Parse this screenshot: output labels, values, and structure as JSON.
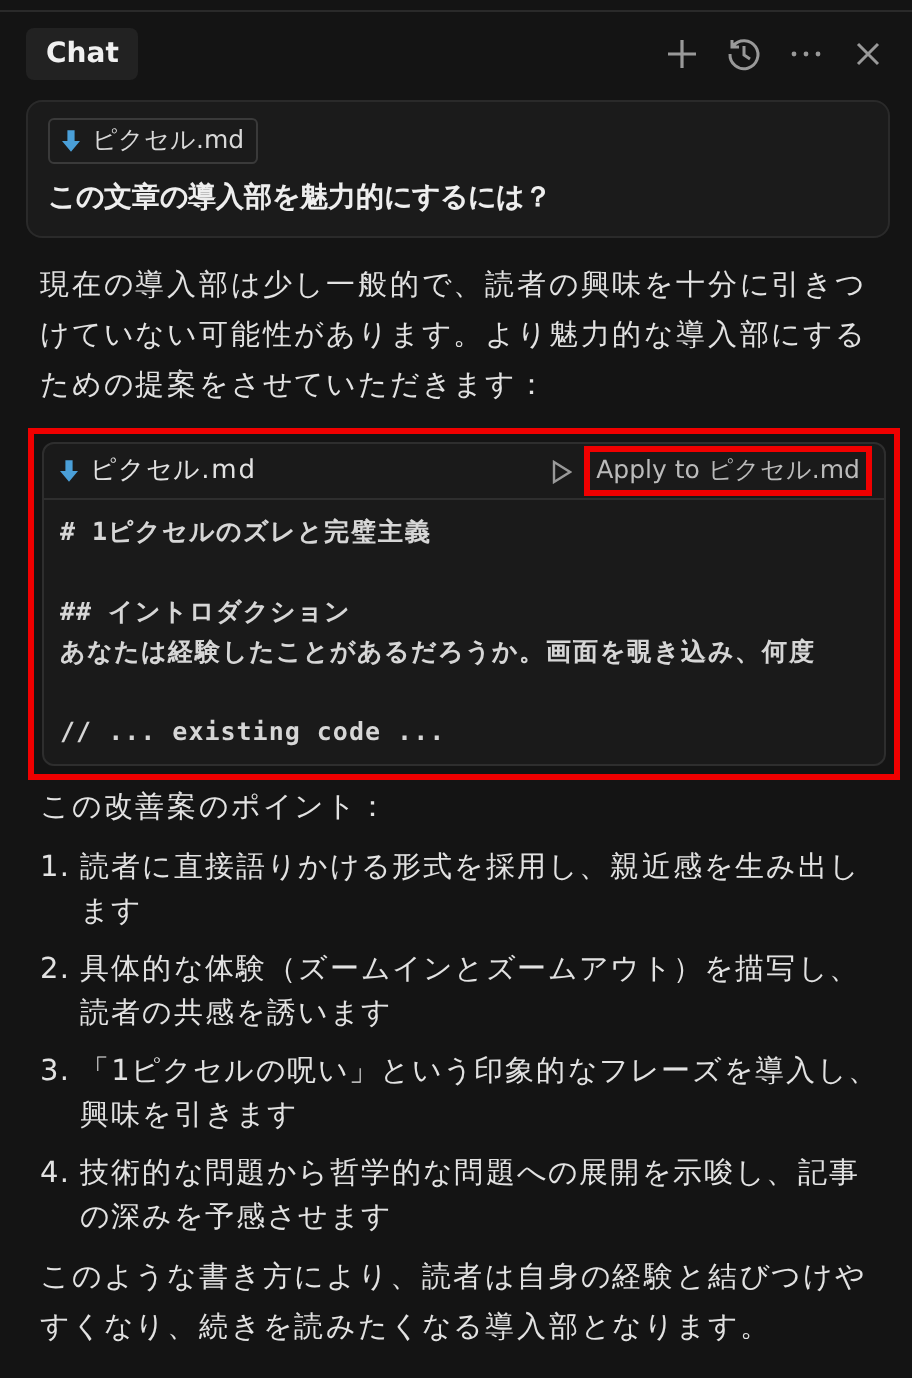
{
  "header": {
    "tab": "Chat"
  },
  "prompt": {
    "attachment": "ピクセル.md",
    "text": "この文章の導入部を魅力的にするには？"
  },
  "response": {
    "intro": "現在の導入部は少し一般的で、読者の興味を十分に引きつけていない可能性があります。より魅力的な導入部にするための提案をさせていただきます：",
    "code_block": {
      "highlighted": true,
      "filename": "ピクセル.md",
      "apply": {
        "label": "Apply to ピクセル.md",
        "highlighted": true
      },
      "lines": [
        {
          "kind": "text",
          "text": "# 1ピクセルのズレと完璧主義"
        },
        {
          "kind": "blank"
        },
        {
          "kind": "text",
          "text": "## イントロダクション"
        },
        {
          "kind": "text",
          "text": "あなたは経験したことがあるだろうか。画面を覗き込み、何度"
        },
        {
          "kind": "blank"
        },
        {
          "kind": "text",
          "text": "// ... existing code ..."
        }
      ]
    },
    "points_title": "この改善案のポイント：",
    "points": [
      {
        "number": "1.",
        "text": "読者に直接語りかける形式を採用し、親近感を生み出します"
      },
      {
        "number": "2.",
        "text": "具体的な体験（ズームインとズームアウト）を描写し、読者の共感を誘います"
      },
      {
        "number": "3.",
        "text": "「1ピクセルの呪い」という印象的なフレーズを導入し、興味を引きます"
      },
      {
        "number": "4.",
        "text": "技術的な問題から哲学的な問題への展開を示唆し、記事の深みを予感させます"
      }
    ],
    "conclusion": "このような書き方により、読者は自身の経験と結びつけやすくなり、続きを読みたくなる導入部となります。"
  }
}
